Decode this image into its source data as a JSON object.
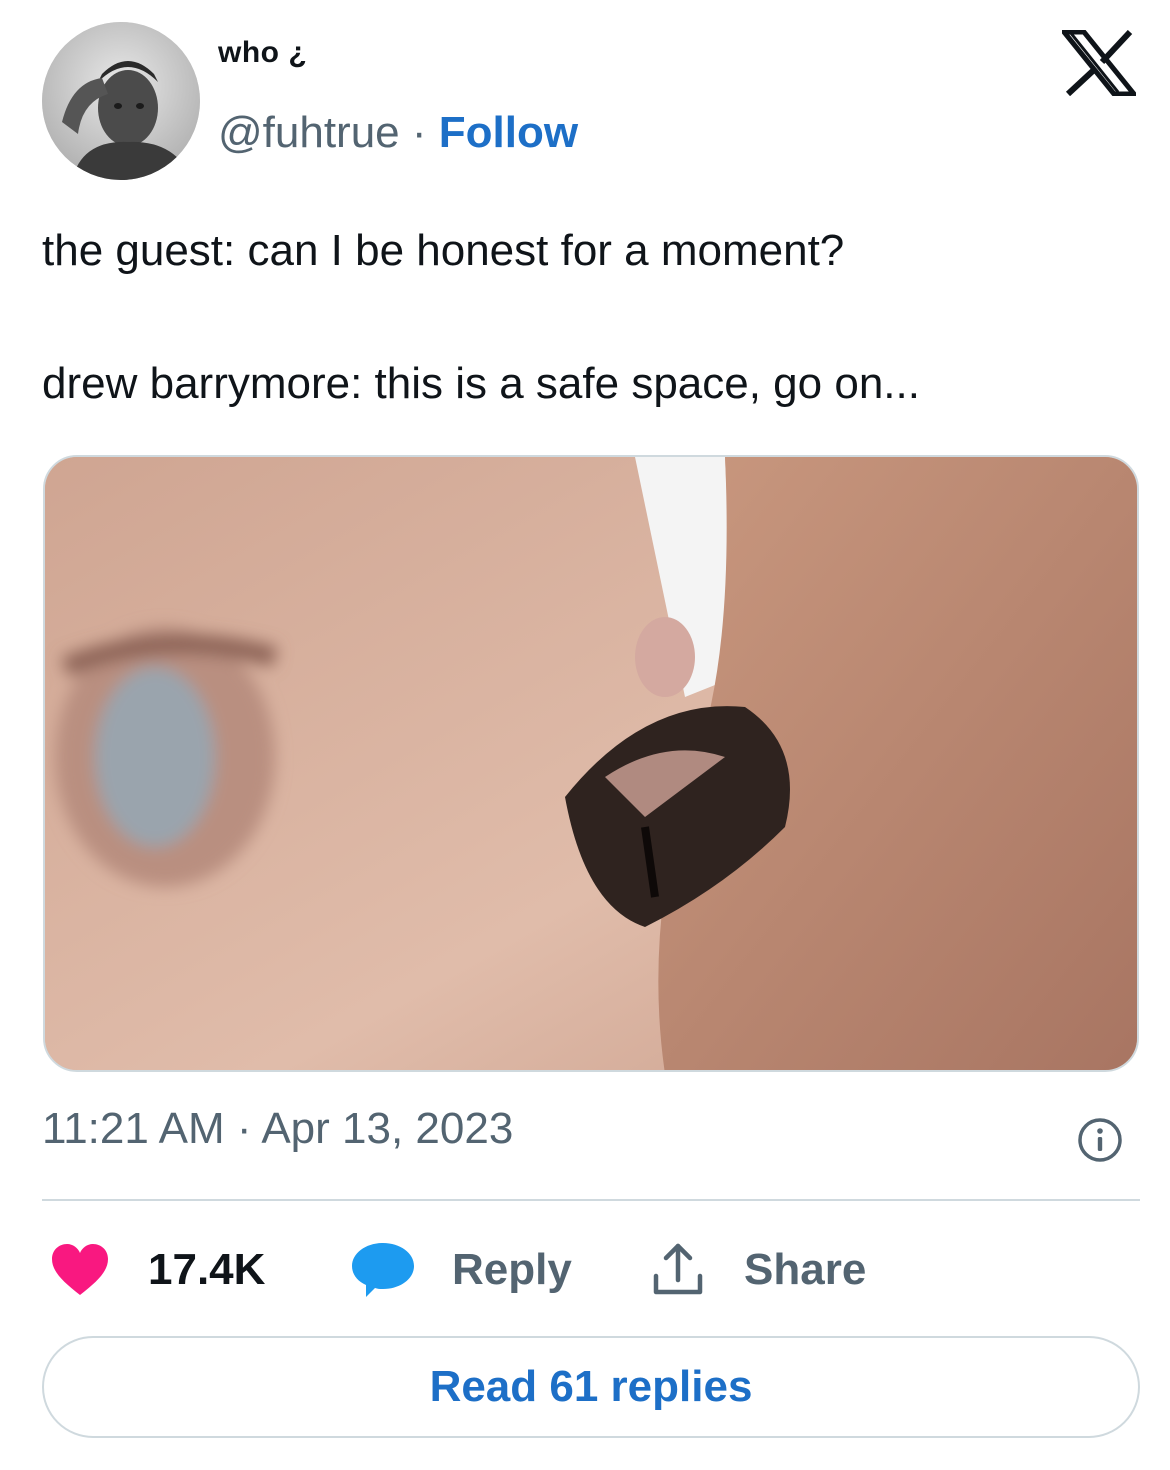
{
  "author": {
    "display_name": "who ¿",
    "handle": "@fuhtrue",
    "separator": " · ",
    "follow_label": "Follow",
    "avatar_icon": "user-avatar-photo"
  },
  "header": {
    "logo_icon": "x-logo-icon"
  },
  "tweet": {
    "line_1": "the guest: can I be honest for a moment?",
    "line_2": "drew barrymore: this is a safe space, go on..."
  },
  "media": {
    "kind": "photo"
  },
  "meta": {
    "time": "11:21 AM",
    "separator": " · ",
    "date": "Apr 13, 2023",
    "info_icon": "info-circle-icon"
  },
  "actions": {
    "like_icon": "heart-icon",
    "like_count": "17.4K",
    "like_color": "#f91880",
    "reply_icon": "speech-bubble-icon",
    "reply_label": "Reply",
    "reply_color": "#1d9bf0",
    "share_icon": "upload-arrow-icon",
    "share_label": "Share"
  },
  "footer": {
    "read_replies_label": "Read 61 replies"
  },
  "colors": {
    "link": "#1d6fc7",
    "secondary_text": "#536471",
    "border": "#cfd9de"
  }
}
